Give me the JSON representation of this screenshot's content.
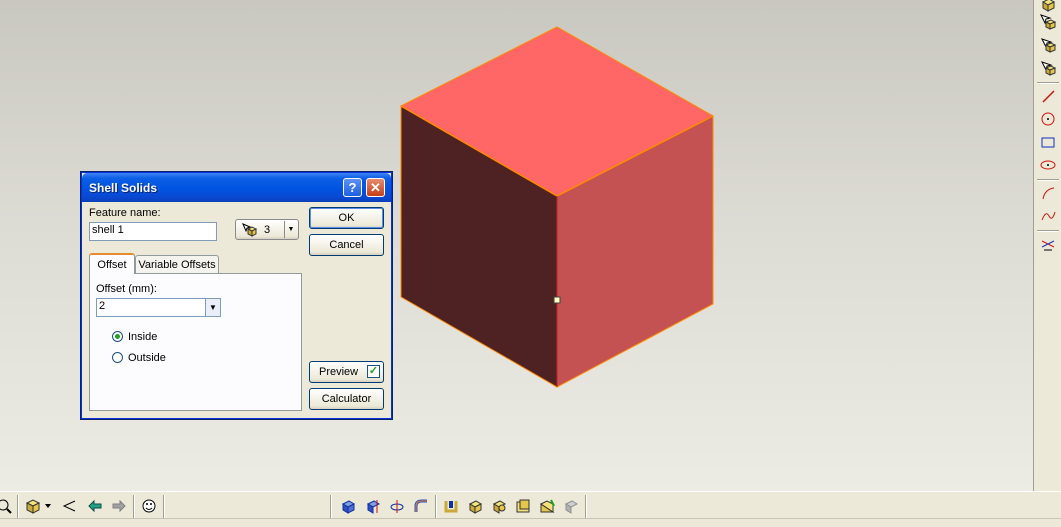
{
  "dialog": {
    "title": "Shell Solids",
    "help_label": "?",
    "close_label": "✕",
    "feature_name_label": "Feature name:",
    "feature_name_value": "shell 1",
    "face_count": "3",
    "ok_label": "OK",
    "cancel_label": "Cancel",
    "tabs": [
      {
        "label": "Offset"
      },
      {
        "label": "Variable Offsets"
      }
    ],
    "offset_label": "Offset (mm):",
    "offset_value": "2",
    "radio_inside": "Inside",
    "radio_outside": "Outside",
    "selected_option": "Inside",
    "preview_label": "Preview",
    "preview_checked": true,
    "calculator_label": "Calculator"
  },
  "colors": {
    "cube_top": "#ff6666",
    "cube_right": "#c55252",
    "cube_left": "#4e2222",
    "cube_edge": "#ff8a00",
    "title_bar": "#0053e1"
  },
  "right_toolbar": {
    "icons": [
      "select-face-icon",
      "select-solid-icon",
      "select-edge-icon",
      "select-body-icon",
      "line-icon",
      "circle-icon",
      "rectangle-icon",
      "ellipse-icon",
      "arc-icon",
      "spline-icon",
      "trim-icon"
    ]
  },
  "bottom_toolbar": {
    "icons": [
      "zoom-icon",
      "view-cube-icon",
      "look-at-icon",
      "back-arrow-icon",
      "forward-arrow-icon",
      "smiley-icon",
      "extrude-icon",
      "revolve-icon",
      "move-icon",
      "sweep-icon",
      "shell-icon",
      "box-icon",
      "cylinder-icon",
      "block-icon",
      "wedge-icon",
      "disabled-icon"
    ]
  }
}
